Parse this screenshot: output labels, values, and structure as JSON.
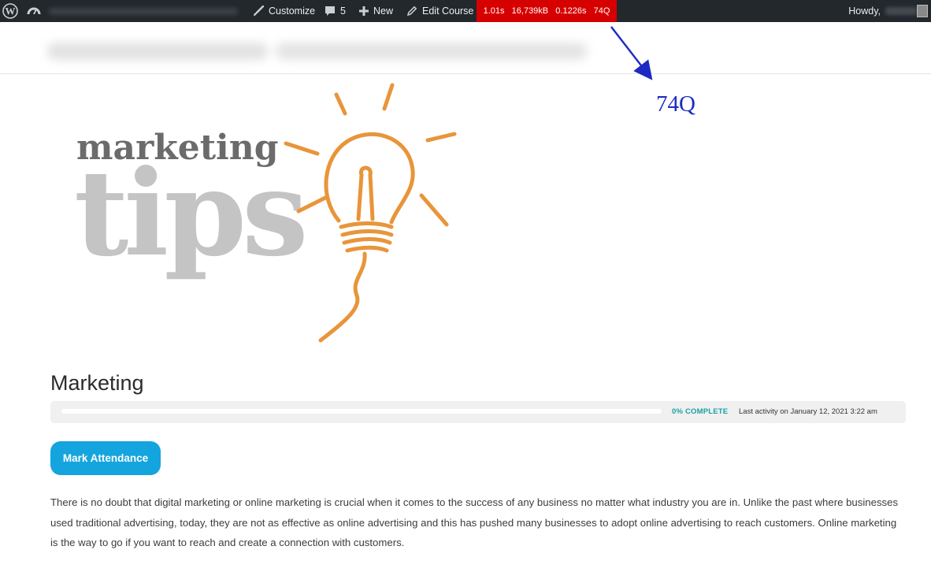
{
  "adminbar": {
    "customize_label": "Customize",
    "comments_count": "5",
    "new_label": "New",
    "edit_course_label": "Edit Course",
    "query_monitor": {
      "time": "1.01s",
      "memory": "16,739kB",
      "db_time": "0.1226s",
      "queries": "74Q"
    },
    "howdy_label": "Howdy,"
  },
  "annotation": {
    "label": "74Q",
    "color": "#1d2bc2"
  },
  "hero": {
    "line1": "marketing",
    "line2": "tips"
  },
  "course": {
    "title": "Marketing",
    "progress_percent": 0,
    "progress_status": "0% COMPLETE",
    "last_activity": "Last activity on January 12, 2021 3:22 am",
    "mark_attendance_label": "Mark Attendance",
    "description": "There is no doubt that digital marketing or online marketing is crucial when it comes to the success of any business no matter what industry you are in. Unlike the past where businesses used traditional advertising, today, they are not as effective as online advertising and this has pushed many businesses to adopt online advertising to reach customers. Online marketing is the way to go if you want to reach and create a connection with customers."
  },
  "colors": {
    "adminbar_bg": "#23282d",
    "query_monitor_bg": "#d60000",
    "accent_button": "#14a4de",
    "progress_status": "#1b9fa4",
    "bulb": "#e8953a"
  },
  "icons": {
    "wp_logo": "wordpress-icon",
    "dashboard": "dashboard-icon",
    "customize": "brush-icon",
    "comments": "comment-icon",
    "new": "plus-icon",
    "edit": "pencil-icon"
  }
}
